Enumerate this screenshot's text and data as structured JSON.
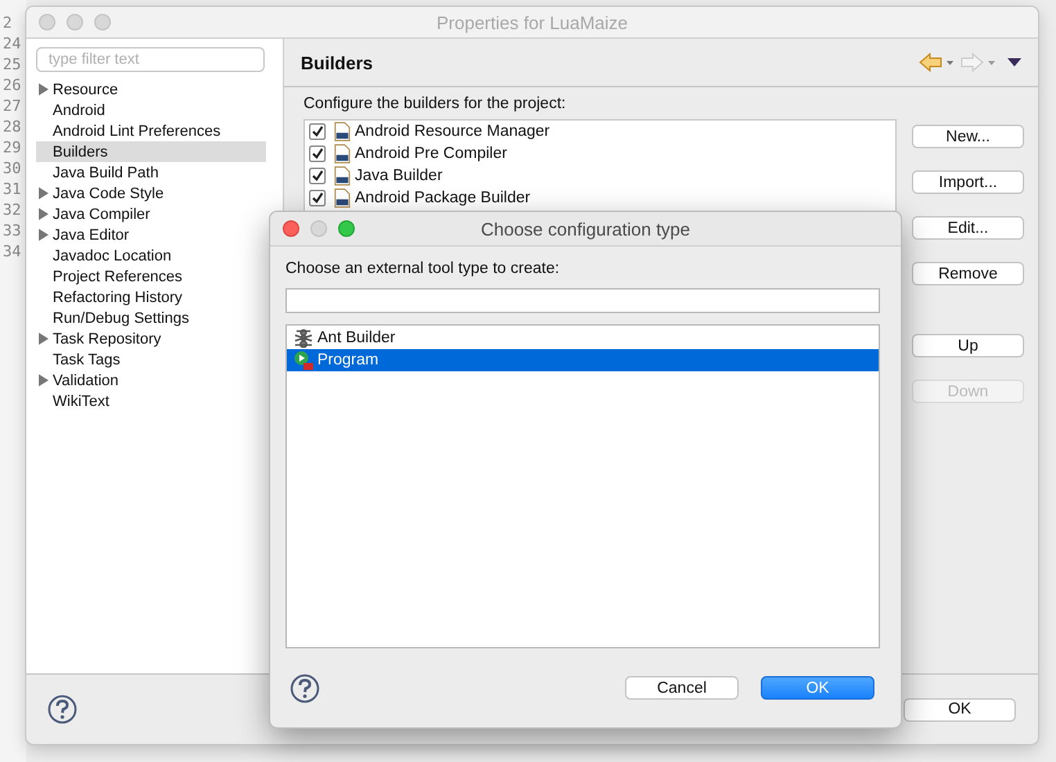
{
  "editor": {
    "line_numbers": [
      "2",
      "24",
      "25",
      "26",
      "27",
      "28",
      "29",
      "30",
      "31",
      "32",
      "33",
      "34"
    ]
  },
  "window": {
    "title": "Properties for LuaMaize"
  },
  "filter": {
    "placeholder": "type filter text"
  },
  "sidebar": {
    "items": [
      {
        "label": "Resource",
        "expandable": true,
        "selected": false
      },
      {
        "label": "Android",
        "expandable": false,
        "selected": false
      },
      {
        "label": "Android Lint Preferences",
        "expandable": false,
        "selected": false
      },
      {
        "label": "Builders",
        "expandable": false,
        "selected": true
      },
      {
        "label": "Java Build Path",
        "expandable": false,
        "selected": false
      },
      {
        "label": "Java Code Style",
        "expandable": true,
        "selected": false
      },
      {
        "label": "Java Compiler",
        "expandable": true,
        "selected": false
      },
      {
        "label": "Java Editor",
        "expandable": true,
        "selected": false
      },
      {
        "label": "Javadoc Location",
        "expandable": false,
        "selected": false
      },
      {
        "label": "Project References",
        "expandable": false,
        "selected": false
      },
      {
        "label": "Refactoring History",
        "expandable": false,
        "selected": false
      },
      {
        "label": "Run/Debug Settings",
        "expandable": false,
        "selected": false
      },
      {
        "label": "Task Repository",
        "expandable": true,
        "selected": false
      },
      {
        "label": "Task Tags",
        "expandable": false,
        "selected": false
      },
      {
        "label": "Validation",
        "expandable": true,
        "selected": false
      },
      {
        "label": "WikiText",
        "expandable": false,
        "selected": false
      }
    ]
  },
  "page": {
    "title": "Builders",
    "description": "Configure the builders for the project:",
    "builders": [
      {
        "label": "Android Resource Manager",
        "checked": true
      },
      {
        "label": "Android Pre Compiler",
        "checked": true
      },
      {
        "label": "Java Builder",
        "checked": true
      },
      {
        "label": "Android Package Builder",
        "checked": true
      }
    ],
    "buttons": [
      {
        "label": "New...",
        "disabled": false
      },
      {
        "label": "Import...",
        "disabled": false
      },
      {
        "label": "Edit...",
        "disabled": false
      },
      {
        "label": "Remove",
        "disabled": false
      },
      {
        "label": "Up",
        "disabled": false
      },
      {
        "label": "Down",
        "disabled": true
      }
    ]
  },
  "footer": {
    "buttons": [
      {
        "label": "OK"
      }
    ]
  },
  "dialog": {
    "title": "Choose configuration type",
    "prompt": "Choose an external tool type to create:",
    "types": [
      {
        "label": "Ant Builder",
        "kind": "ant",
        "selected": false
      },
      {
        "label": "Program",
        "kind": "program",
        "selected": true
      }
    ],
    "buttons": [
      {
        "label": "Cancel",
        "default": false
      },
      {
        "label": "OK",
        "default": true
      }
    ]
  }
}
